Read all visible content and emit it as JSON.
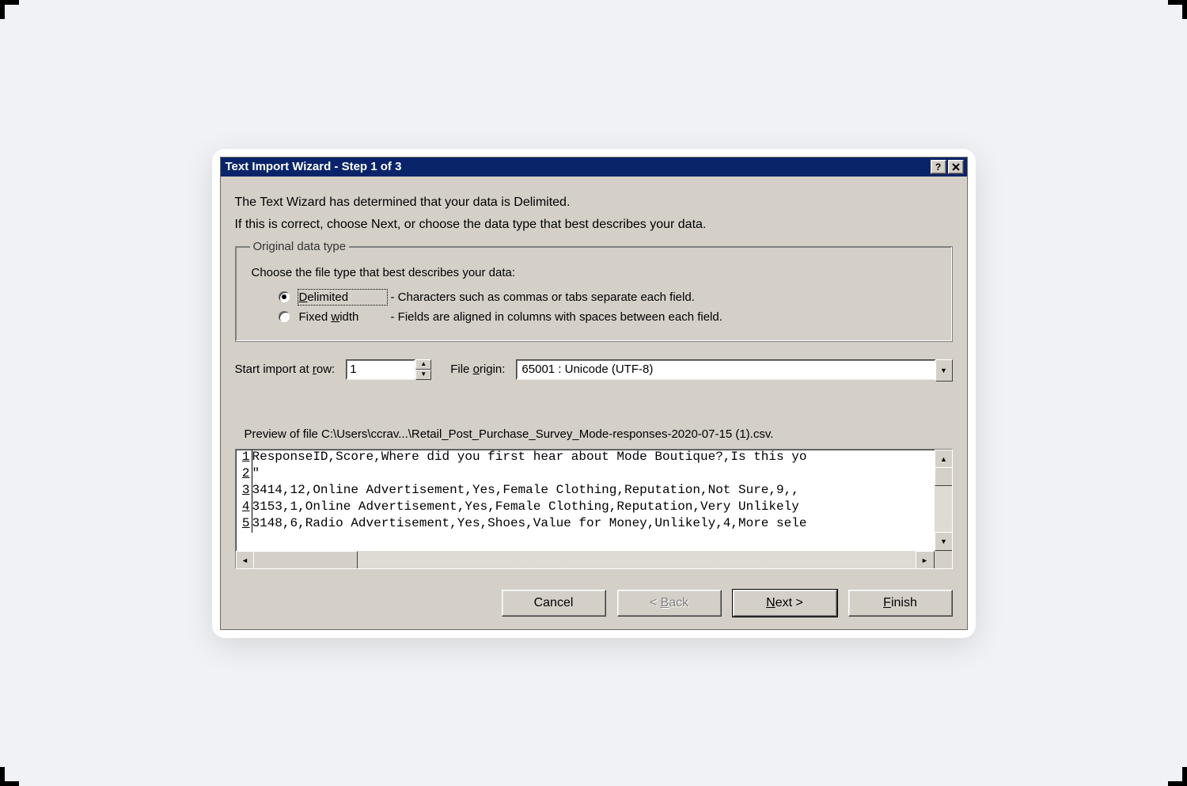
{
  "window": {
    "title": "Text Import Wizard - Step 1 of 3"
  },
  "intro": {
    "line1": "The Text Wizard has determined that your data is Delimited.",
    "line2": "If this is correct, choose Next, or choose the data type that best describes your data."
  },
  "group": {
    "legend": "Original data type",
    "instruction": "Choose the file type that best describes your data:",
    "options": [
      {
        "label_pre": "",
        "underline": "D",
        "label_post": "elimited",
        "description": "- Characters such as commas or tabs separate each field.",
        "selected": true
      },
      {
        "label_pre": "Fixed ",
        "underline": "w",
        "label_post": "idth",
        "description": "- Fields are aligned in columns with spaces between each field.",
        "selected": false
      }
    ]
  },
  "controls": {
    "start_row_label_pre": "Start import at ",
    "start_row_underline": "r",
    "start_row_label_post": "ow:",
    "start_row_value": "1",
    "file_origin_label_pre": "File ",
    "file_origin_underline": "o",
    "file_origin_label_post": "rigin:",
    "file_origin_value": "65001 : Unicode (UTF-8)"
  },
  "preview": {
    "label": "Preview of file C:\\Users\\ccrav...\\Retail_Post_Purchase_Survey_Mode-responses-2020-07-15 (1).csv.",
    "rows": [
      {
        "n": "1",
        "text": "ResponseID,Score,Where did you first hear about Mode Boutique?,Is this yo"
      },
      {
        "n": "2",
        "text": "\""
      },
      {
        "n": "3",
        "text": "3414,12,Online Advertisement,Yes,Female Clothing,Reputation,Not Sure,9,,"
      },
      {
        "n": "4",
        "text": "3153,1,Online Advertisement,Yes,Female Clothing,Reputation,Very Unlikely"
      },
      {
        "n": "5",
        "text": "3148,6,Radio Advertisement,Yes,Shoes,Value for Money,Unlikely,4,More sele"
      }
    ]
  },
  "buttons": {
    "cancel": "Cancel",
    "back_pre": "< ",
    "back_u": "B",
    "back_post": "ack",
    "next_u": "N",
    "next_post": "ext >",
    "finish_u": "F",
    "finish_post": "inish"
  }
}
